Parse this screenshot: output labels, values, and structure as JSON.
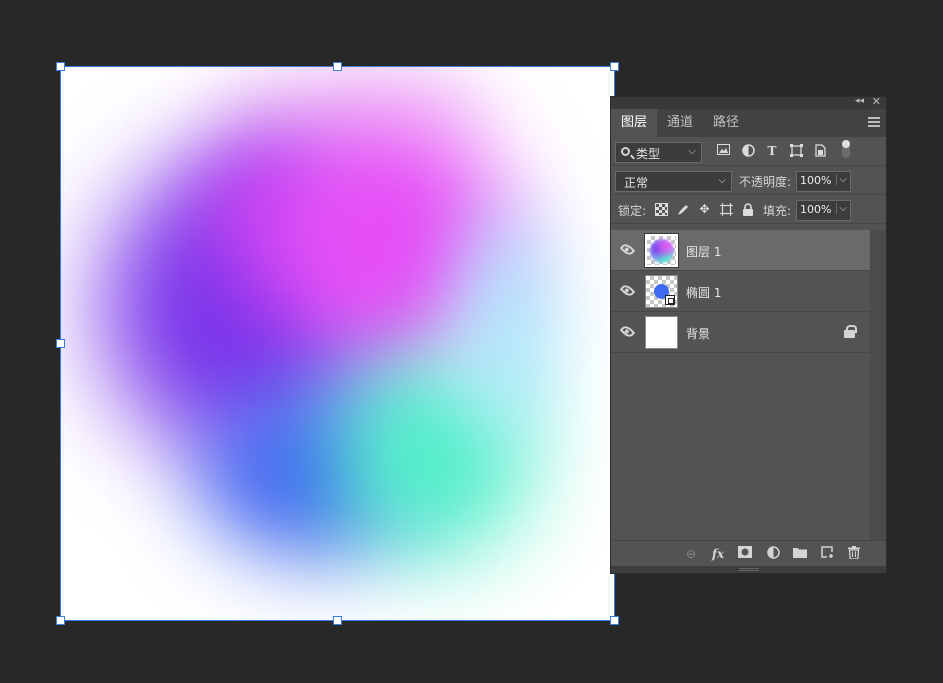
{
  "canvas": {
    "handles": 8
  },
  "panel": {
    "tabs": [
      {
        "label": "图层",
        "active": true
      },
      {
        "label": "通道",
        "active": false
      },
      {
        "label": "路径",
        "active": false
      }
    ],
    "filter": {
      "kind_label": "类型",
      "icons": [
        "image-filter-icon",
        "adjustment-filter-icon",
        "type-filter-icon",
        "shape-filter-icon",
        "smart-object-filter-icon"
      ]
    },
    "blend": {
      "mode": "正常",
      "opacity_label": "不透明度:",
      "opacity_value": "100%"
    },
    "lock": {
      "label": "锁定:",
      "fill_label": "填充:",
      "fill_value": "100%"
    },
    "layers": [
      {
        "name": "图层 1",
        "selected": true,
        "thumb": "gradient"
      },
      {
        "name": "椭圆 1",
        "selected": false,
        "thumb": "ellipse"
      },
      {
        "name": "背景",
        "selected": false,
        "thumb": "white",
        "locked": true
      }
    ],
    "footer_icons": [
      "link-layers-icon",
      "fx-icon",
      "add-mask-icon",
      "new-adjustment-icon",
      "new-group-icon",
      "new-layer-icon",
      "delete-layer-icon"
    ],
    "glyphs": {
      "collapse": "◂◂",
      "close": "✕",
      "chevron": "⌵",
      "type_t": "T",
      "crosshair": "✥",
      "fx": "fx",
      "link": "⊖",
      "folder": "▬",
      "trash": "🗑"
    }
  }
}
